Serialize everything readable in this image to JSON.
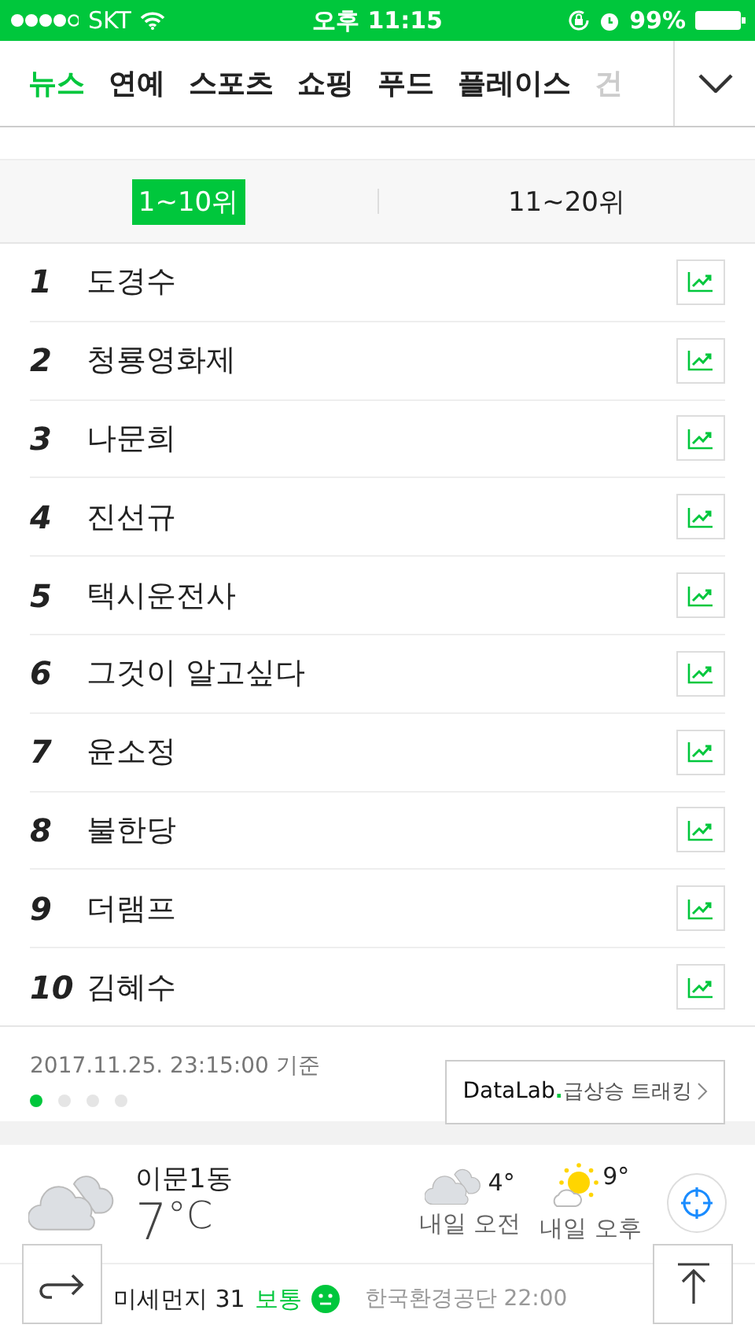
{
  "status_bar": {
    "carrier": "SKT",
    "time": "오후 11:15",
    "battery": "99%"
  },
  "tabs": [
    {
      "label": "뉴스",
      "selected": true
    },
    {
      "label": "연예",
      "selected": false
    },
    {
      "label": "스포츠",
      "selected": false
    },
    {
      "label": "쇼핑",
      "selected": false
    },
    {
      "label": "푸드",
      "selected": false
    },
    {
      "label": "플레이스",
      "selected": false
    },
    {
      "label": "건",
      "selected": false
    }
  ],
  "range_tabs": [
    {
      "label": "1~10위",
      "selected": true
    },
    {
      "label": "11~20위",
      "selected": false
    }
  ],
  "ranking": [
    {
      "rank": "1",
      "keyword": "도경수"
    },
    {
      "rank": "2",
      "keyword": "청룡영화제"
    },
    {
      "rank": "3",
      "keyword": "나문희"
    },
    {
      "rank": "4",
      "keyword": "진선규"
    },
    {
      "rank": "5",
      "keyword": "택시운전사"
    },
    {
      "rank": "6",
      "keyword": "그것이 알고싶다"
    },
    {
      "rank": "7",
      "keyword": "윤소정"
    },
    {
      "rank": "8",
      "keyword": "불한당"
    },
    {
      "rank": "9",
      "keyword": "더램프"
    },
    {
      "rank": "10",
      "keyword": "김혜수"
    }
  ],
  "timestamp": "2017.11.25. 23:15:00 기준",
  "pager": [
    {
      "selected": true
    },
    {
      "selected": false
    },
    {
      "selected": false
    },
    {
      "selected": false
    }
  ],
  "datalab_button": {
    "brand": "DataLab",
    "dot": ".",
    "label": "급상승 트래킹"
  },
  "weather": {
    "location": "이문1동",
    "temperature": "7",
    "unit": "°C",
    "forecast": [
      {
        "kind": "cloudy",
        "temp": "4°",
        "label": "내일 오전"
      },
      {
        "kind": "sunny",
        "temp": "9°",
        "label": "내일 오후"
      }
    ]
  },
  "dust": {
    "label": "미세먼지",
    "value": "31",
    "grade": "보통",
    "source": "한국환경공단 22:00"
  }
}
